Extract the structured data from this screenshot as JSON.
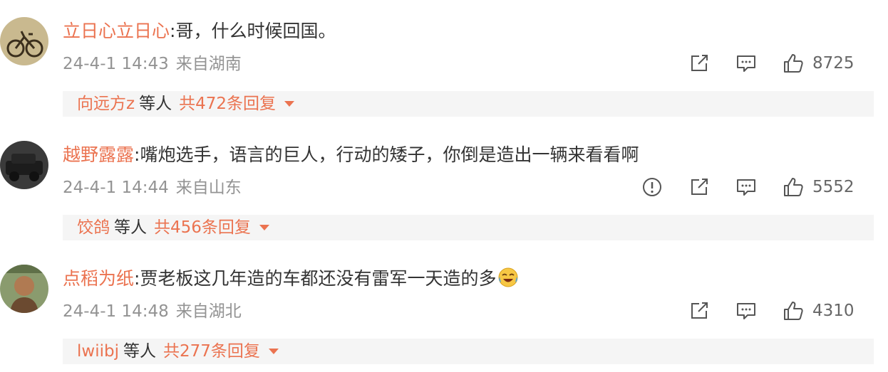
{
  "comments": [
    {
      "username": "立日心立日心",
      "text": "哥，什么时候回国。",
      "time": "24-4-1 14:43",
      "location": "来自湖南",
      "likes": "8725",
      "reply_user": "向远方z",
      "reply_mid": "等人",
      "reply_count": "共472条回复",
      "has_report": false,
      "has_emoji": false
    },
    {
      "username": "越野露露",
      "text": "嘴炮选手，语言的巨人，行动的矮子，你倒是造出一辆来看看啊",
      "time": "24-4-1 14:44",
      "location": "来自山东",
      "likes": "5552",
      "reply_user": "饺鸽",
      "reply_mid": "等人",
      "reply_count": "共456条回复",
      "has_report": true,
      "has_emoji": false
    },
    {
      "username": "点稻为纸",
      "text": "贾老板这几年造的车都还没有雷军一天造的多",
      "time": "24-4-1 14:48",
      "location": "来自湖北",
      "likes": "4310",
      "reply_user": "lwiibj",
      "reply_mid": "等人",
      "reply_count": "共277条回复",
      "has_report": false,
      "has_emoji": true,
      "emoji_icon": "laugh-cry-emoji-icon"
    }
  ],
  "separator": ":",
  "colors": {
    "username": "#eb7350",
    "meta": "#939393",
    "text": "#333333",
    "reply_bg": "#f5f5f5"
  }
}
